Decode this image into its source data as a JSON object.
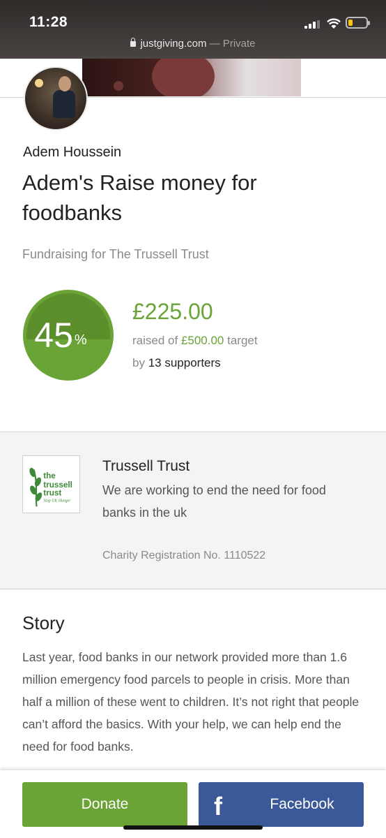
{
  "status_bar": {
    "time": "11:28",
    "url": "justgiving.com",
    "private_label": "— Private"
  },
  "fundraiser": {
    "name": "Adem Houssein",
    "title": "Adem's Raise money for foodbanks",
    "fundraising_for": "Fundraising for The Trussell Trust"
  },
  "progress": {
    "percent": 45,
    "percent_label": "45",
    "percent_symbol": "%",
    "amount_raised": "£225.00",
    "raised_prefix": "raised of",
    "target": "£500.00",
    "target_suffix": "target",
    "supporters_prefix": "by",
    "supporters": "13 supporters"
  },
  "charity": {
    "logo_text": [
      "the",
      "trussell",
      "trust",
      "Stop UK Hunger"
    ],
    "name": "Trussell Trust",
    "description": "We are working to end the need for food banks in the uk",
    "registration": "Charity Registration No. 1110522"
  },
  "story": {
    "heading": "Story",
    "text": "Last year, food banks in our network provided more than 1.6 million emergency food parcels to people in crisis. More than half a million of these went to children. It’s not right that people can’t afford the basics. With your help, we can help end the need for food banks."
  },
  "actions": {
    "donate_label": "Donate",
    "facebook_label": "Facebook"
  },
  "colors": {
    "brand_green": "#6aa336",
    "facebook_blue": "#3b5998"
  },
  "icons": {
    "lock": "lock-icon",
    "facebook": "facebook-icon"
  }
}
